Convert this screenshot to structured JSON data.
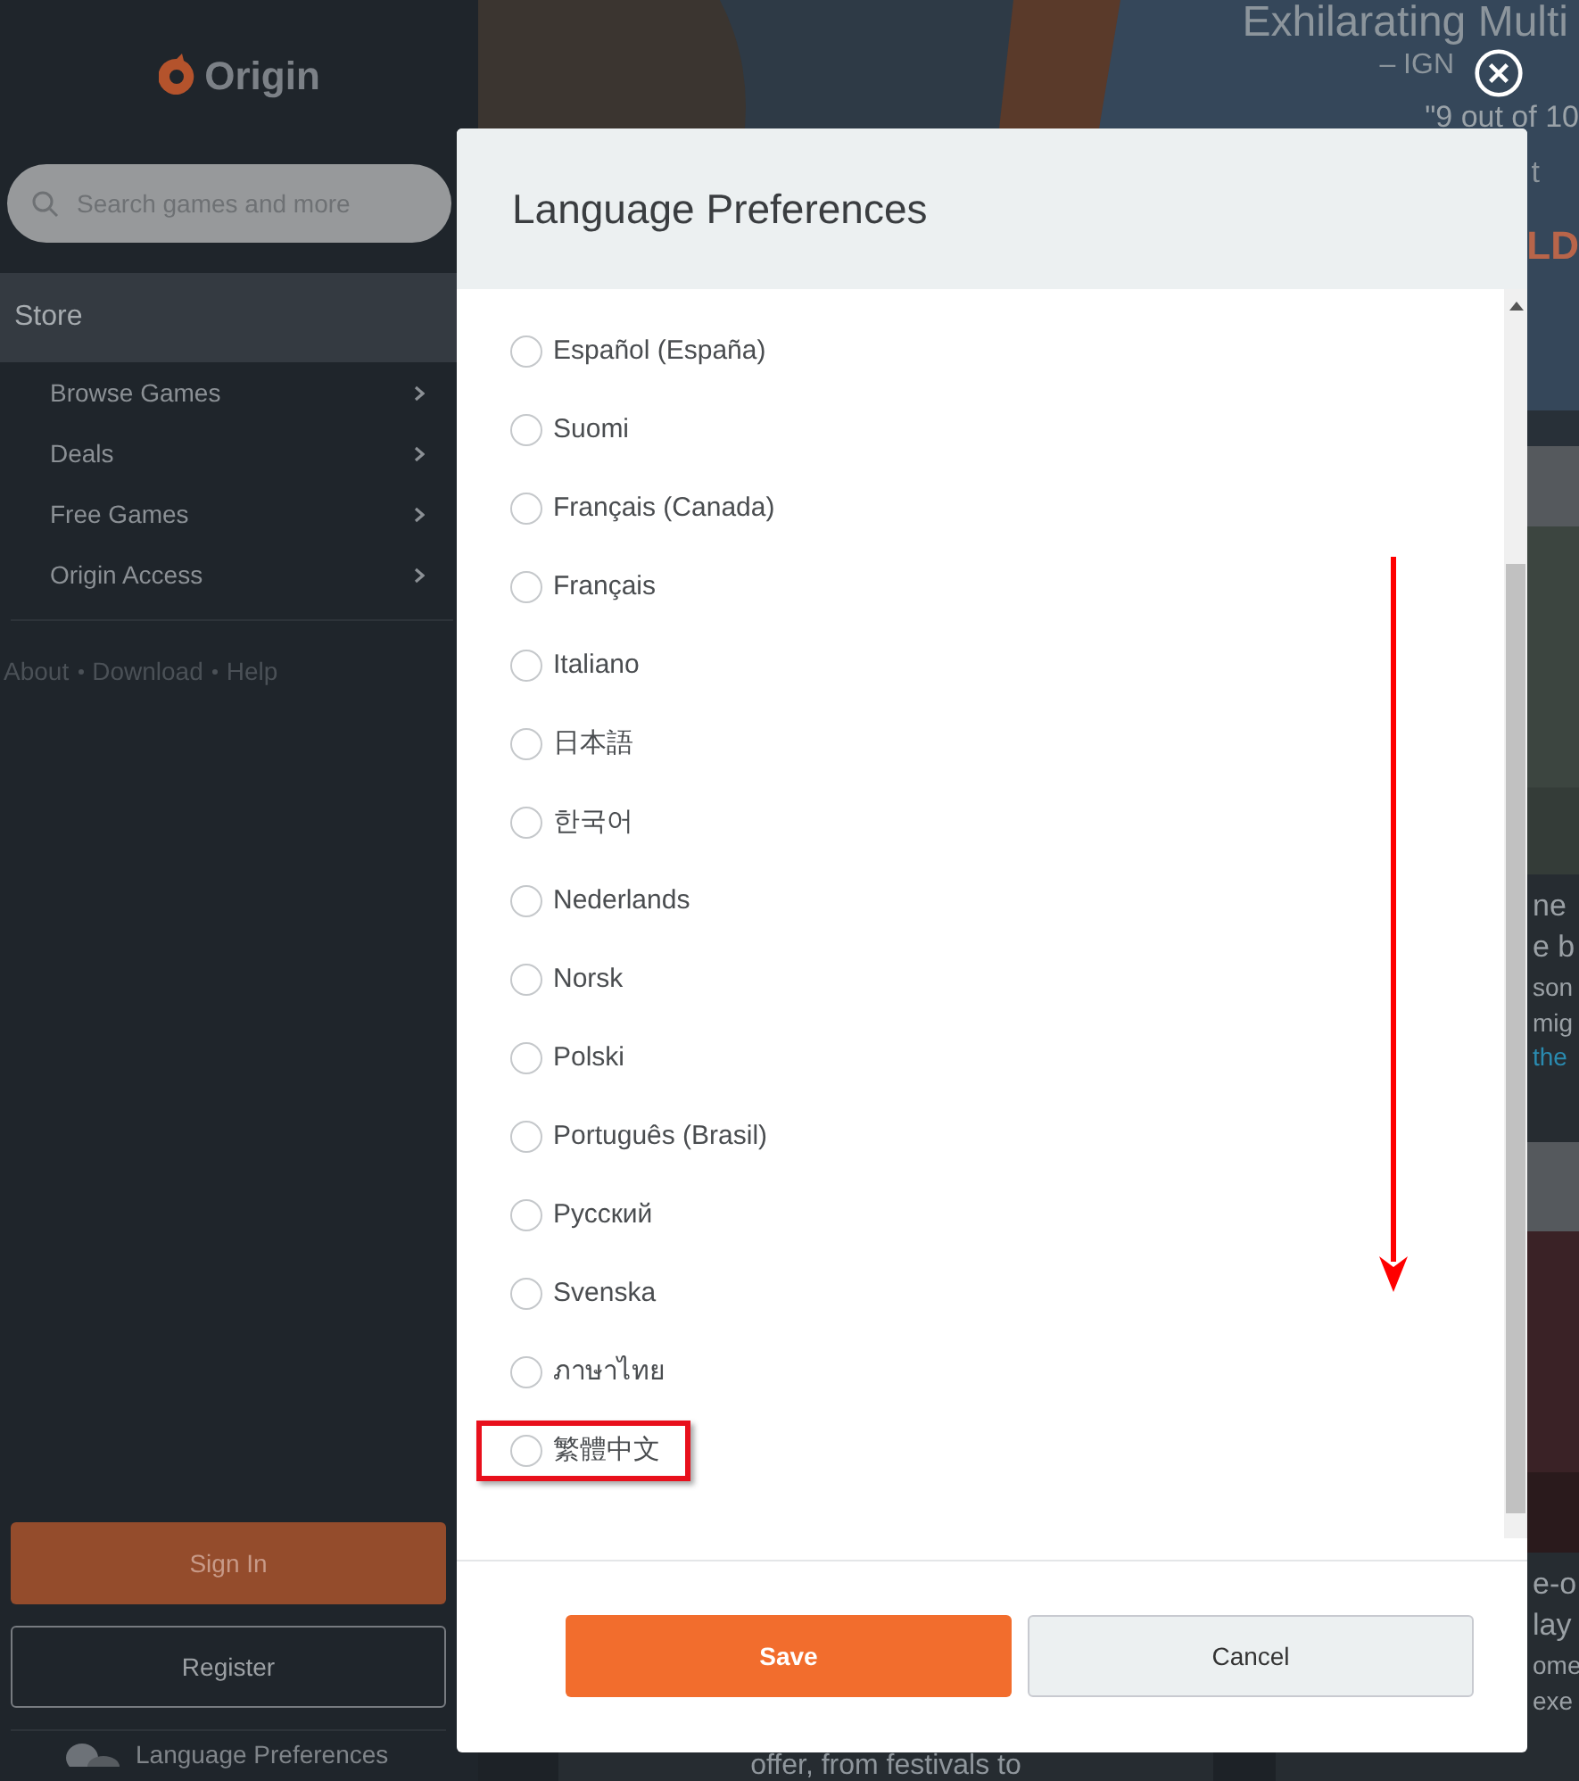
{
  "sidebar": {
    "logo": "Origin",
    "search": {
      "placeholder": "Search games and more"
    },
    "section": "Store",
    "nav": [
      {
        "label": "Browse Games"
      },
      {
        "label": "Deals"
      },
      {
        "label": "Free Games"
      },
      {
        "label": "Origin Access"
      }
    ],
    "links": [
      "About",
      "Download",
      "Help"
    ],
    "sign_in": "Sign In",
    "register": "Register",
    "language": "Language Preferences"
  },
  "hero": {
    "lines": [
      {
        "kind": "heading",
        "text": "Exhilarating Multi"
      },
      {
        "kind": "source",
        "text": "– IGN"
      },
      {
        "kind": "quote",
        "text": "\"9 out of 10"
      },
      {
        "kind": "fragment",
        "text": "t"
      },
      {
        "kind": "logo",
        "text": "LD"
      }
    ]
  },
  "cards": [
    {
      "lines": [
        {
          "kind": "title",
          "text": "ne"
        },
        {
          "kind": "title",
          "text": "e b"
        },
        {
          "kind": "body",
          "text": "son"
        },
        {
          "kind": "body",
          "text": "mig"
        },
        {
          "kind": "link",
          "text": "the"
        }
      ]
    },
    {
      "lines": [
        {
          "kind": "title",
          "text": "e-o"
        },
        {
          "kind": "title",
          "text": "lay"
        },
        {
          "kind": "body",
          "text": "ome"
        },
        {
          "kind": "body",
          "text": "exe"
        }
      ]
    }
  ],
  "bottom_text": "offer, from festivals to",
  "dialog": {
    "title": "Language Preferences",
    "options": [
      {
        "label": "Español (España)",
        "selected": false
      },
      {
        "label": "Suomi",
        "selected": false
      },
      {
        "label": "Français (Canada)",
        "selected": false
      },
      {
        "label": "Français",
        "selected": false
      },
      {
        "label": "Italiano",
        "selected": false
      },
      {
        "label": "日本語",
        "selected": false
      },
      {
        "label": "한국어",
        "selected": false
      },
      {
        "label": "Nederlands",
        "selected": false
      },
      {
        "label": "Norsk",
        "selected": false
      },
      {
        "label": "Polski",
        "selected": false
      },
      {
        "label": "Português (Brasil)",
        "selected": false
      },
      {
        "label": "Русский",
        "selected": false
      },
      {
        "label": "Svenska",
        "selected": false
      },
      {
        "label": "ภาษาไทย",
        "selected": false
      },
      {
        "label": "繁體中文",
        "selected": false,
        "highlighted": true
      }
    ],
    "buttons": [
      {
        "kind": "primary",
        "label": "Save"
      },
      {
        "kind": "secondary",
        "label": "Cancel"
      }
    ]
  }
}
